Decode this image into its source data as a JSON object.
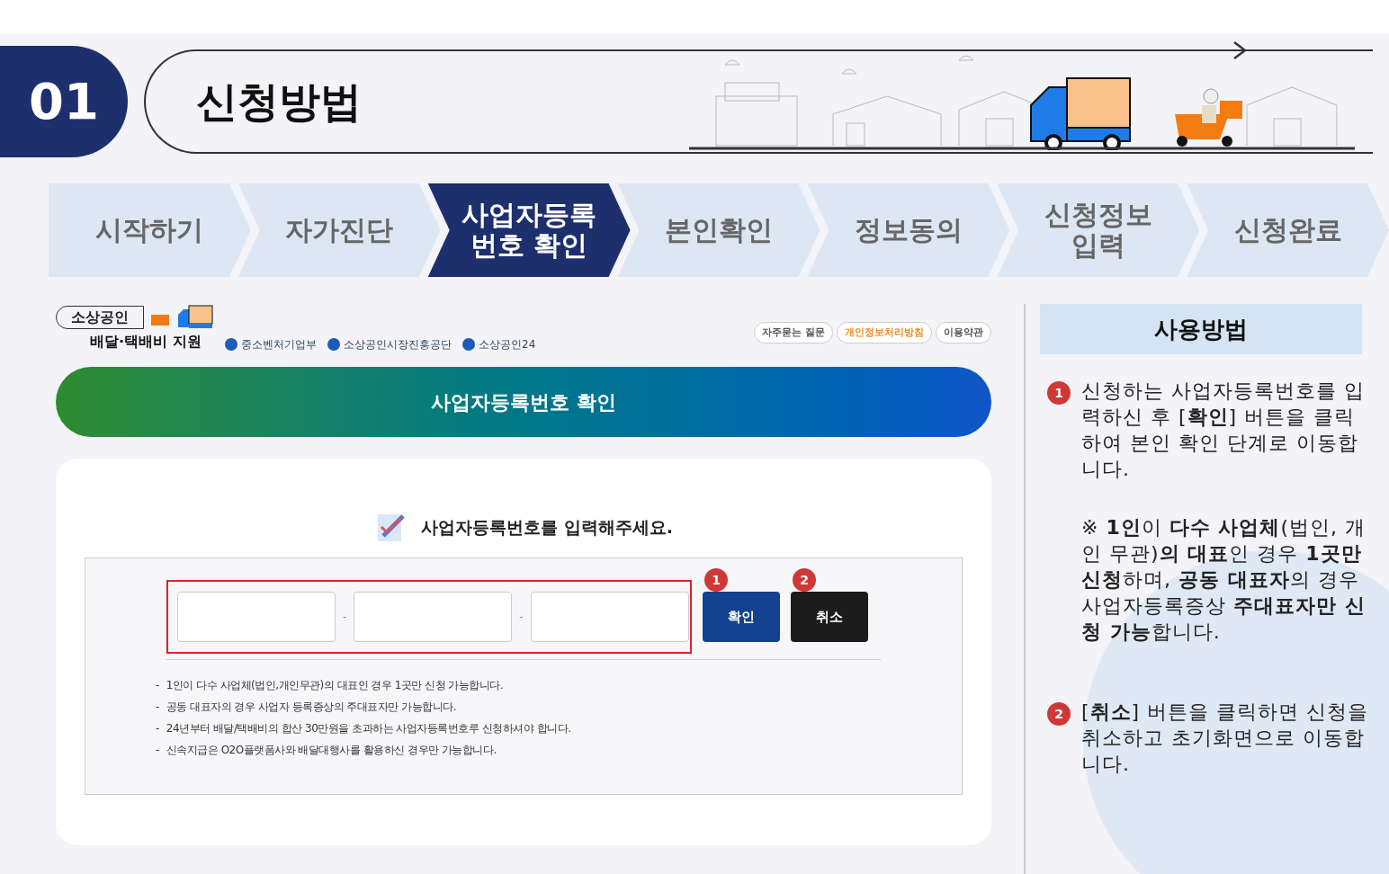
{
  "header": {
    "number": "01",
    "title": "신청방법"
  },
  "steps": [
    {
      "label": "시작하기",
      "selected": false
    },
    {
      "label": "자가진단",
      "selected": false
    },
    {
      "label": "사업자등록\n번호 확인",
      "selected": true
    },
    {
      "label": "본인확인",
      "selected": false
    },
    {
      "label": "정보동의",
      "selected": false
    },
    {
      "label": "신청정보\n입력",
      "selected": false
    },
    {
      "label": "신청완료",
      "selected": false
    }
  ],
  "brand": {
    "badge": "소상공인",
    "subtitle": "배달·택배비 지원",
    "partners": [
      "중소벤처기업부",
      "소상공인시장진흥공단",
      "소상공인24"
    ]
  },
  "top_links": [
    {
      "label": "자주묻는 질문",
      "color": "#555555"
    },
    {
      "label": "개인정보처리방침",
      "color": "#f08a24"
    },
    {
      "label": "이용약관",
      "color": "#555555"
    }
  ],
  "banner": "사업자등록번호 확인",
  "prompt": "사업자등록번호를 입력해주세요.",
  "separators": [
    "-",
    "-"
  ],
  "buttons": [
    {
      "label": "확인",
      "marker": "1",
      "kind": "primary"
    },
    {
      "label": "취소",
      "marker": "2",
      "kind": "dark"
    }
  ],
  "notes": [
    {
      "bullet": "-",
      "text": "1인이 다수 사업체(법인,개인무관)의 대표인 경우 1곳만 신청 가능합니다."
    },
    {
      "bullet": "-",
      "text": "공동 대표자의 경우 사업자 등록증상의 주대표자만 가능합니다."
    },
    {
      "bullet": "-",
      "text": "24년부터 배달/택배비의 합산 30만원을 초과하는 사업자등록번호루 신청하셔야 합니다."
    },
    {
      "bullet": "-",
      "text": "신속지급은 O2O플랫폼사와 배달대행사를 활용하신 경우만 가능합니다."
    }
  ],
  "guide": {
    "title": "사용방법",
    "items": [
      {
        "marker": "1",
        "paragraphs": [
          "신청하는 사업자등록번호를 입력하신 후 [**확인**] 버튼을 클릭하여 본인 확인 단계로 이동합니다.",
          "※ **1인**이 **다수 사업체**(법인, 개인 무관)**의 대표**인 경우 **1곳만 신청**하며, **공동 대표자**의 경우 사업자등록증상 **주대표자만 신청 가능**합니다."
        ]
      },
      {
        "marker": "2",
        "paragraphs": [
          "[**취소**] 버튼을 클릭하면 신청을 취소하고 초기화면으로 이동합니다."
        ]
      }
    ]
  }
}
